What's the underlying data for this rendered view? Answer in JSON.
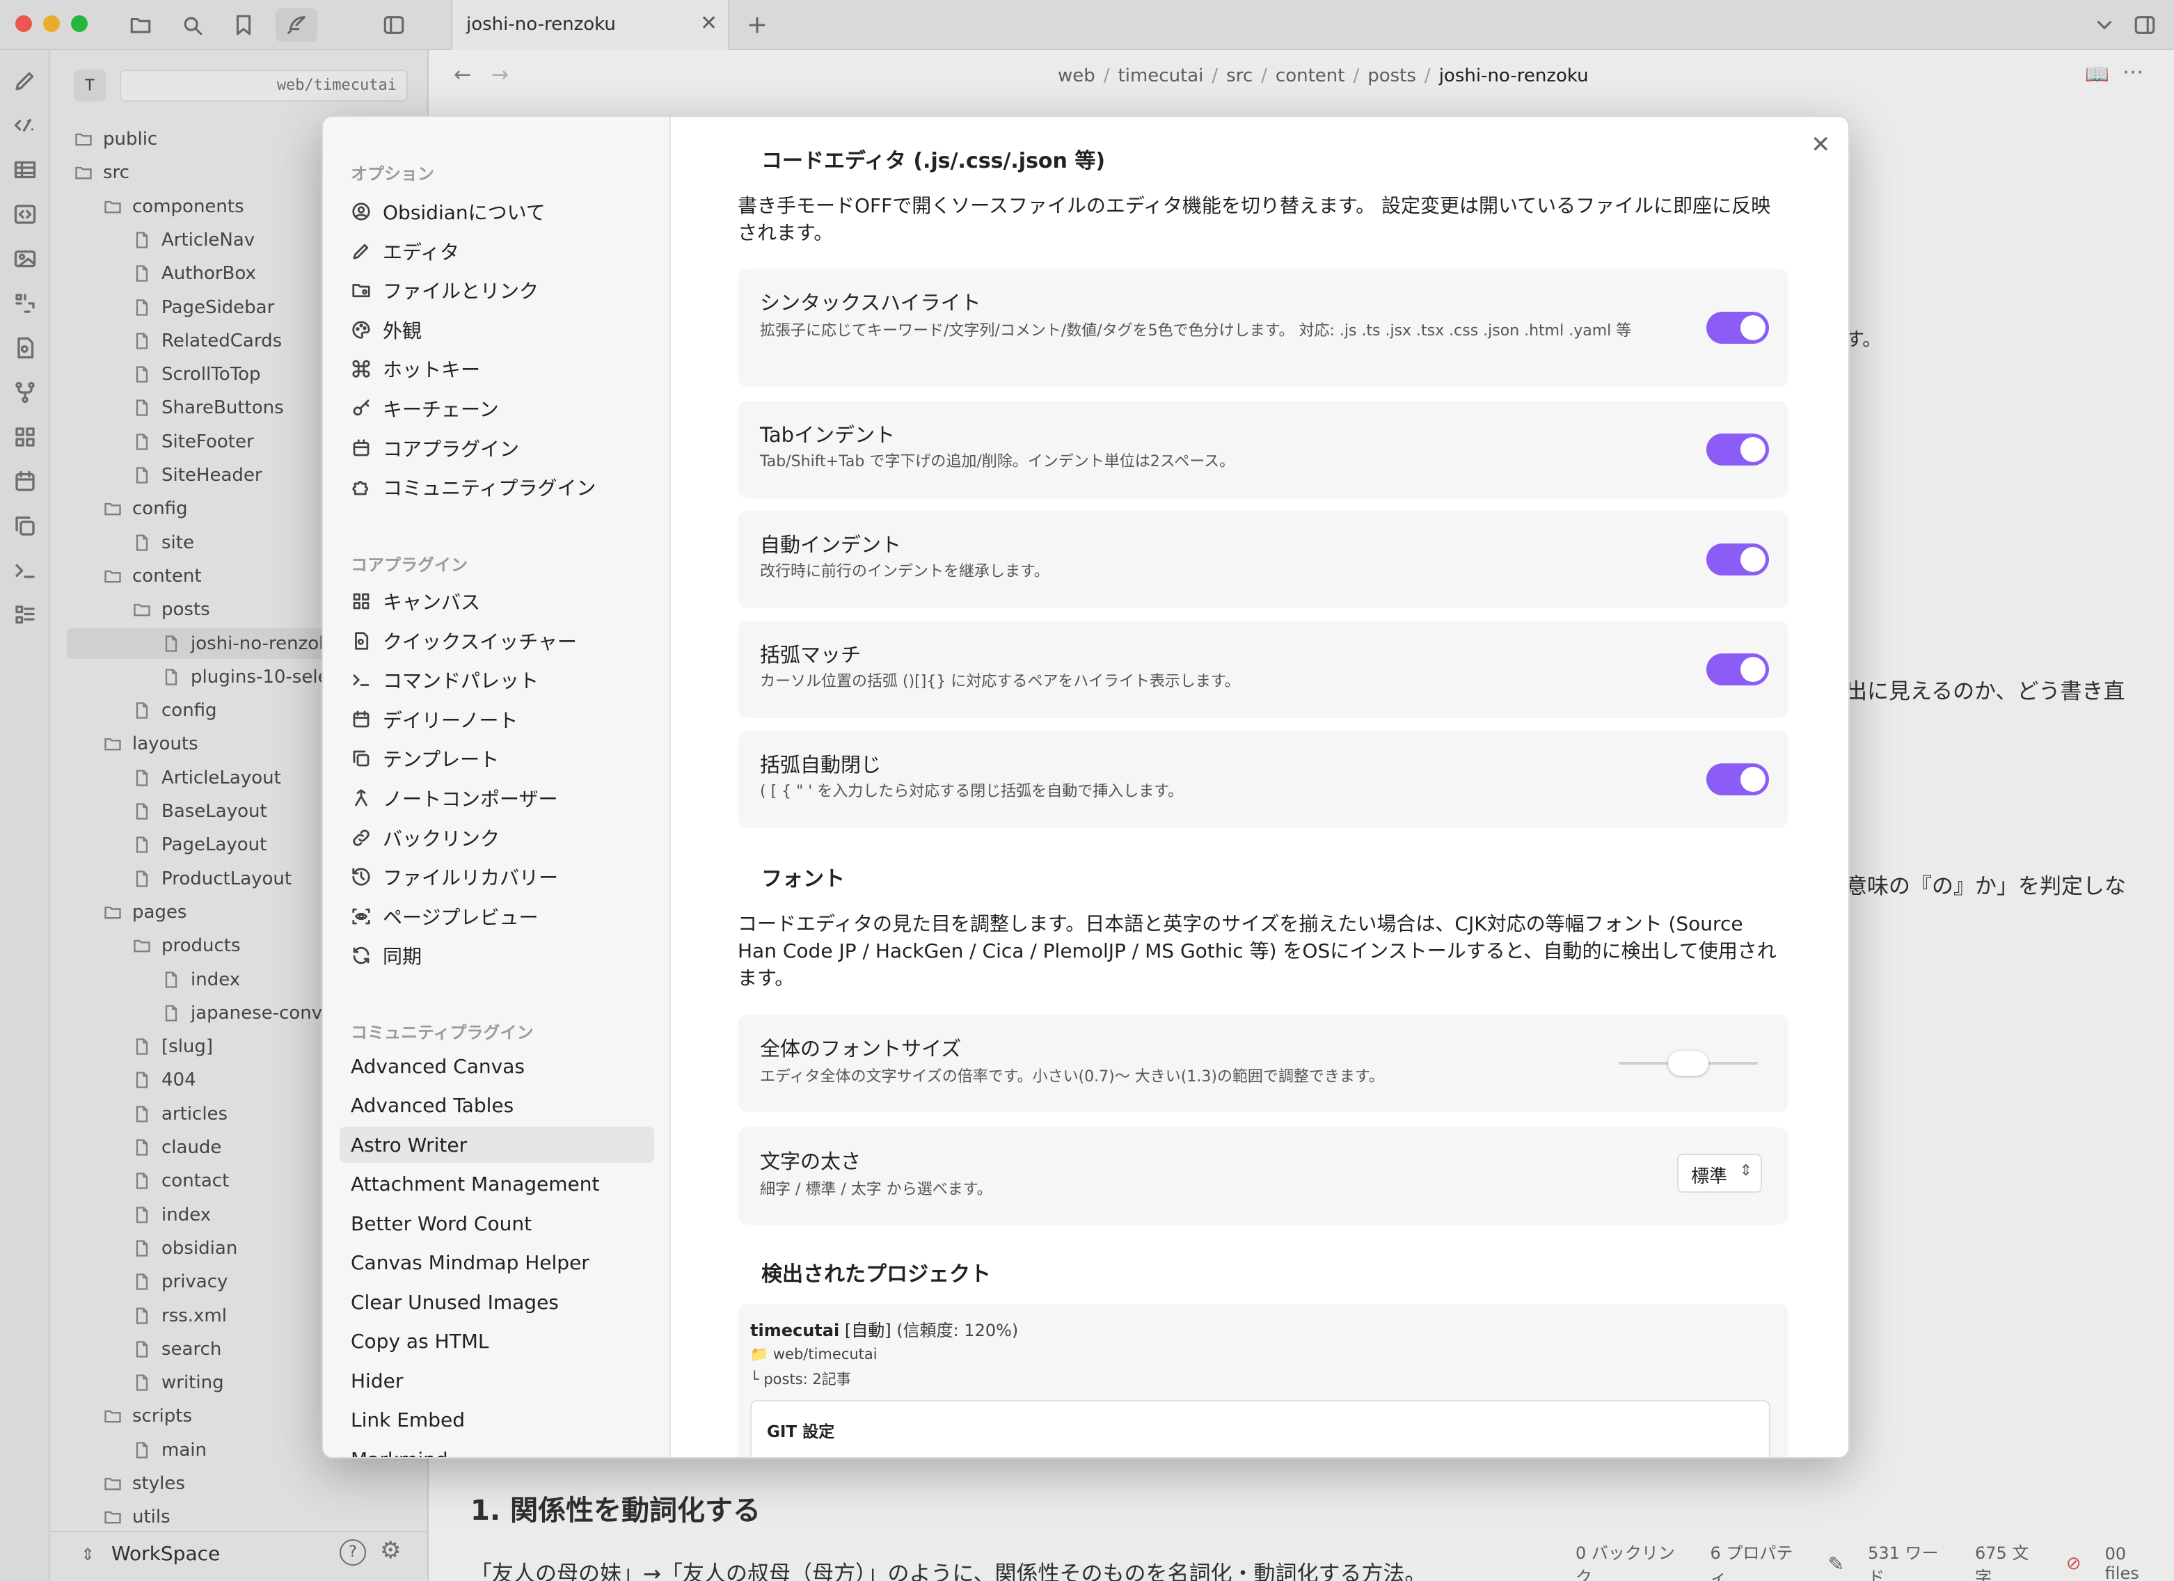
{
  "window": {
    "tab_title": "joshi-no-renzoku"
  },
  "breadcrumb": [
    "web",
    "timecutai",
    "src",
    "content",
    "posts",
    "joshi-no-renzoku"
  ],
  "breadcrumb_sep": "/",
  "sidebar": {
    "vault_badge": "T",
    "vault_path": "web/timecutai",
    "workspace": "WorkSpace",
    "tree": [
      {
        "label": "public",
        "type": "folder",
        "depth": 0
      },
      {
        "label": "src",
        "type": "folder",
        "depth": 0
      },
      {
        "label": "components",
        "type": "folder",
        "depth": 1
      },
      {
        "label": "ArticleNav",
        "type": "file",
        "depth": 2
      },
      {
        "label": "AuthorBox",
        "type": "file",
        "depth": 2
      },
      {
        "label": "PageSidebar",
        "type": "file",
        "depth": 2
      },
      {
        "label": "RelatedCards",
        "type": "file",
        "depth": 2
      },
      {
        "label": "ScrollToTop",
        "type": "file",
        "depth": 2
      },
      {
        "label": "ShareButtons",
        "type": "file",
        "depth": 2
      },
      {
        "label": "SiteFooter",
        "type": "file",
        "depth": 2
      },
      {
        "label": "SiteHeader",
        "type": "file",
        "depth": 2
      },
      {
        "label": "config",
        "type": "folder",
        "depth": 1
      },
      {
        "label": "site",
        "type": "file",
        "depth": 2
      },
      {
        "label": "content",
        "type": "folder",
        "depth": 1
      },
      {
        "label": "posts",
        "type": "folder",
        "depth": 2
      },
      {
        "label": "joshi-no-renzoku",
        "type": "file",
        "depth": 3,
        "active": true
      },
      {
        "label": "plugins-10-sele",
        "type": "file",
        "depth": 3
      },
      {
        "label": "config",
        "type": "file",
        "depth": 2
      },
      {
        "label": "layouts",
        "type": "folder",
        "depth": 1
      },
      {
        "label": "ArticleLayout",
        "type": "file",
        "depth": 2
      },
      {
        "label": "BaseLayout",
        "type": "file",
        "depth": 2
      },
      {
        "label": "PageLayout",
        "type": "file",
        "depth": 2
      },
      {
        "label": "ProductLayout",
        "type": "file",
        "depth": 2
      },
      {
        "label": "pages",
        "type": "folder",
        "depth": 1
      },
      {
        "label": "products",
        "type": "folder",
        "depth": 2
      },
      {
        "label": "index",
        "type": "file",
        "depth": 3
      },
      {
        "label": "japanese-conve",
        "type": "file",
        "depth": 3
      },
      {
        "label": "[slug]",
        "type": "file",
        "depth": 2
      },
      {
        "label": "404",
        "type": "file",
        "depth": 2
      },
      {
        "label": "articles",
        "type": "file",
        "depth": 2
      },
      {
        "label": "claude",
        "type": "file",
        "depth": 2
      },
      {
        "label": "contact",
        "type": "file",
        "depth": 2
      },
      {
        "label": "index",
        "type": "file",
        "depth": 2
      },
      {
        "label": "obsidian",
        "type": "file",
        "depth": 2
      },
      {
        "label": "privacy",
        "type": "file",
        "depth": 2
      },
      {
        "label": "rss.xml",
        "type": "file",
        "depth": 2
      },
      {
        "label": "search",
        "type": "file",
        "depth": 2
      },
      {
        "label": "writing",
        "type": "file",
        "depth": 2
      },
      {
        "label": "scripts",
        "type": "folder",
        "depth": 1
      },
      {
        "label": "main",
        "type": "file",
        "depth": 2
      },
      {
        "label": "styles",
        "type": "folder",
        "depth": 1
      },
      {
        "label": "utils",
        "type": "folder",
        "depth": 1
      }
    ]
  },
  "editor": {
    "fragment_1": "す。",
    "fragment_2": "出に見えるのか、どう書き直",
    "fragment_3": "意味の『の』か」を判定しな",
    "heading": "1. 関係性を動詞化する",
    "paragraph": "「友人の母の妹」→「友人の叔母（母方）」のように、関係性そのものを名詞化・動詞化する方法。"
  },
  "statusbar": {
    "backlinks": "0 バックリンク",
    "properties": "6 プロパティ",
    "words": "531 ワード",
    "chars": "675 文字",
    "files": "00 files"
  },
  "settings_nav": {
    "options_header": "オプション",
    "options": [
      {
        "label": "Obsidianについて",
        "icon": "user-circle-icon"
      },
      {
        "label": "エディタ",
        "icon": "pencil-icon"
      },
      {
        "label": "ファイルとリンク",
        "icon": "folder-cog-icon"
      },
      {
        "label": "外観",
        "icon": "palette-icon"
      },
      {
        "label": "ホットキー",
        "icon": "command-icon"
      },
      {
        "label": "キーチェーン",
        "icon": "key-icon"
      },
      {
        "label": "コアプラグイン",
        "icon": "plugin-icon"
      },
      {
        "label": "コミュニティプラグイン",
        "icon": "puzzle-icon"
      }
    ],
    "core_header": "コアプラグイン",
    "core": [
      {
        "label": "キャンバス",
        "icon": "layout-grid-icon"
      },
      {
        "label": "クイックスイッチャー",
        "icon": "file-search-icon"
      },
      {
        "label": "コマンドパレット",
        "icon": "terminal-icon"
      },
      {
        "label": "デイリーノート",
        "icon": "calendar-icon"
      },
      {
        "label": "テンプレート",
        "icon": "files-icon"
      },
      {
        "label": "ノートコンポーザー",
        "icon": "merge-icon"
      },
      {
        "label": "バックリンク",
        "icon": "link-icon"
      },
      {
        "label": "ファイルリカバリー",
        "icon": "history-icon"
      },
      {
        "label": "ページプレビュー",
        "icon": "scan-eye-icon"
      },
      {
        "label": "同期",
        "icon": "refresh-icon"
      }
    ],
    "community_header": "コミュニティプラグイン",
    "community": [
      "Advanced Canvas",
      "Advanced Tables",
      "Astro Writer",
      "Attachment Management",
      "Better Word Count",
      "Canvas Mindmap Helper",
      "Clear Unused Images",
      "Copy as HTML",
      "Hider",
      "Link Embed",
      "Markmind"
    ],
    "community_active": 2
  },
  "settings_content": {
    "code_editor_title": "コードエディタ (.js/.css/.json 等)",
    "code_editor_desc": "書き手モードOFFで開くソースファイルのエディタ機能を切り替えます。 設定変更は開いているファイルに即座に反映されます。",
    "toggles": [
      {
        "name": "シンタックスハイライト",
        "desc": "拡張子に応じてキーワード/文字列/コメント/数値/タグを5色で色分けします。 対応: .js .ts .jsx .tsx .css .json .html .yaml 等",
        "on": true
      },
      {
        "name": "Tabインデント",
        "desc": "Tab/Shift+Tab で字下げの追加/削除。インデント単位は2スペース。",
        "on": true
      },
      {
        "name": "自動インデント",
        "desc": "改行時に前行のインデントを継承します。",
        "on": true
      },
      {
        "name": "括弧マッチ",
        "desc": "カーソル位置の括弧 ()[]{} に対応するペアをハイライト表示します。",
        "on": true
      },
      {
        "name": "括弧自動閉じ",
        "desc": "( [ { \" ' を入力したら対応する閉じ括弧を自動で挿入します。",
        "on": true
      }
    ],
    "font_title": "フォント",
    "font_desc": "コードエディタの見た目を調整します。日本語と英字のサイズを揃えたい場合は、CJK対応の等幅フォント (Source Han Code JP / HackGen / Cica / PlemolJP / MS Gothic 等) をOSにインストールすると、自動的に検出して使用されます。",
    "font_size": {
      "name": "全体のフォントサイズ",
      "desc": "エディタ全体の文字サイズの倍率です。小さい(0.7)〜 大きい(1.3)の範囲で調整できます。",
      "slider_fraction": 0.5
    },
    "font_weight": {
      "name": "文字の太さ",
      "desc": "細字 / 標準 / 太字 から選べます。",
      "value": "標準"
    },
    "projects_title": "検出されたプロジェクト",
    "project": {
      "name": "timecutai",
      "tag": "[自動]",
      "confidence": "(信頼度: 120%)",
      "path": "web/timecutai",
      "posts": "└ posts: 2記事",
      "git_title": "GIT 設定"
    }
  },
  "colors": {
    "accent": "#8b5cf6",
    "tab_bg": "#f8f8f8",
    "sidebar_bg": "#f1f1f1"
  }
}
